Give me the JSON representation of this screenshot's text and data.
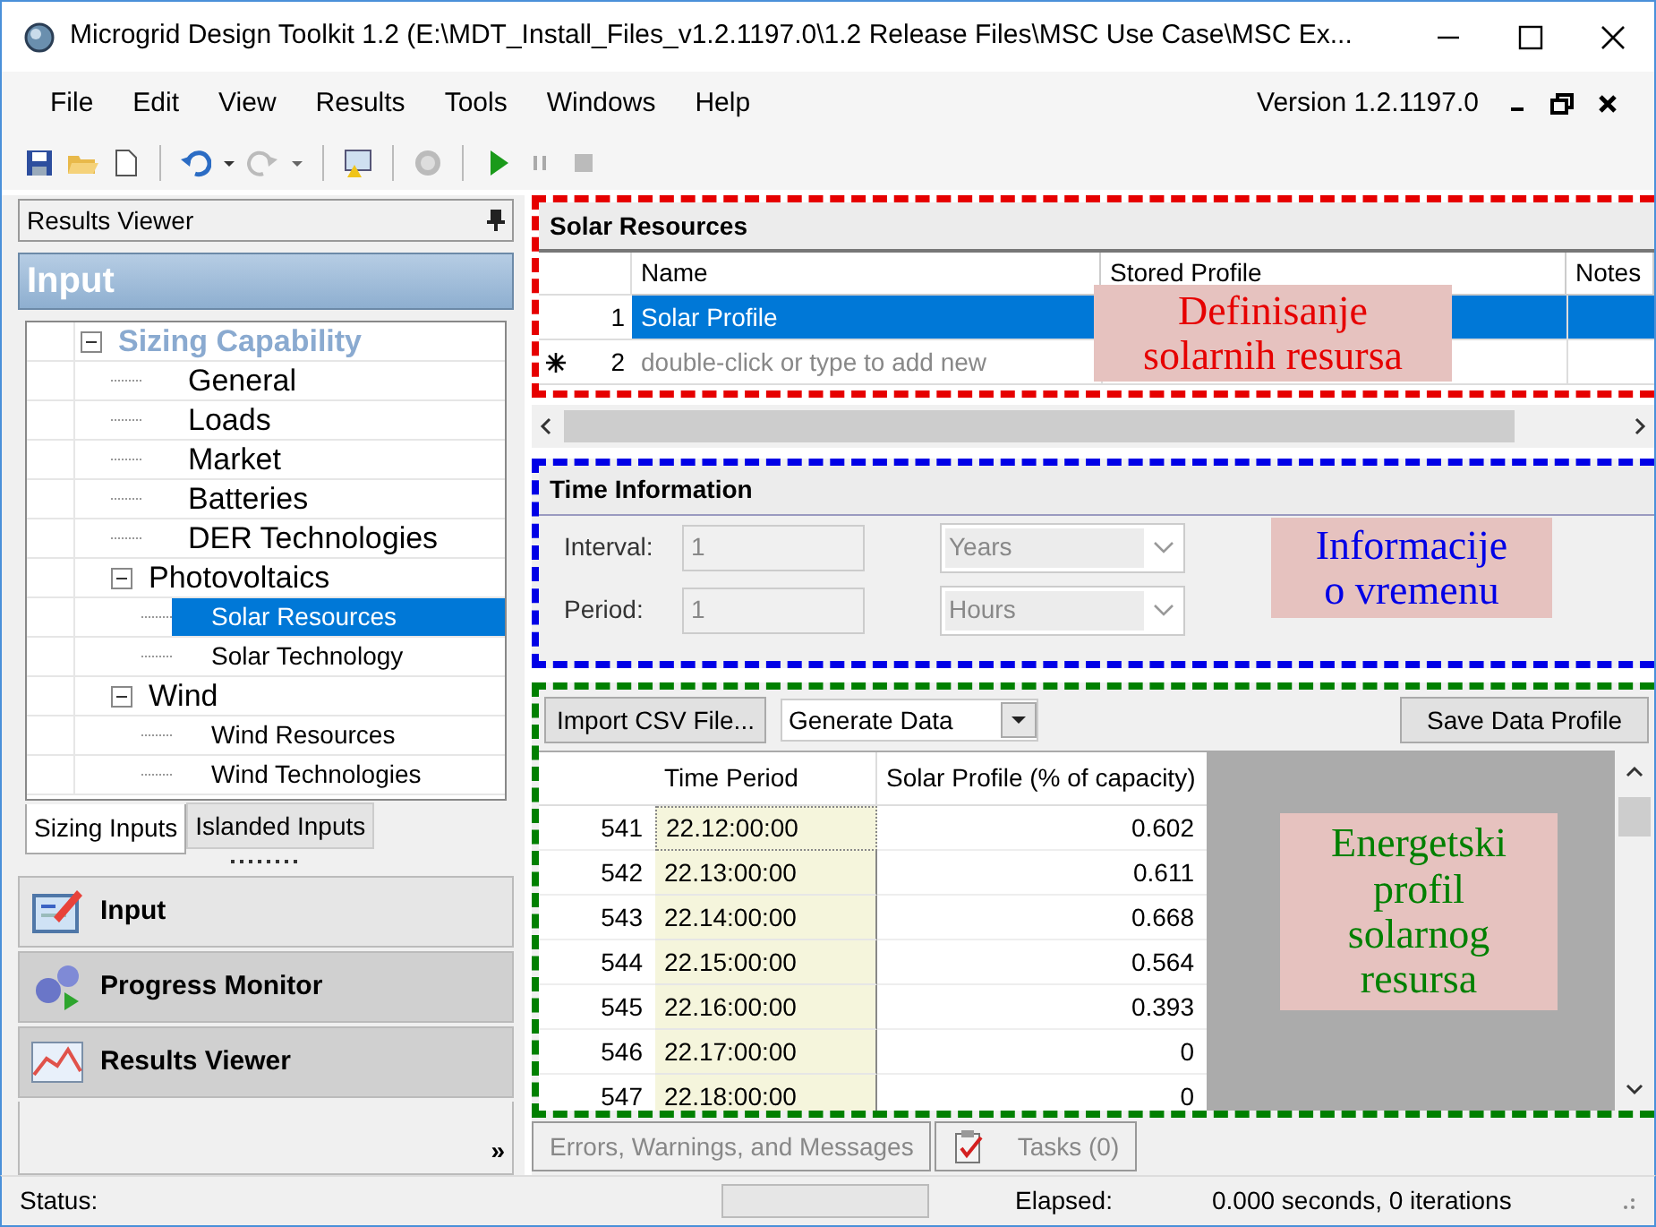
{
  "window": {
    "title": "Microgrid Design Toolkit 1.2 (E:\\MDT_Install_Files_v1.2.1197.0\\1.2 Release Files\\MSC Use Case\\MSC Ex..."
  },
  "menu": [
    "File",
    "Edit",
    "View",
    "Results",
    "Tools",
    "Windows",
    "Help"
  ],
  "version": "Version 1.2.1197.0",
  "left_panel": {
    "header": "Results Viewer",
    "section_title": "Input",
    "tree": [
      {
        "label": "Sizing Capability",
        "expanded": true,
        "children": [
          {
            "label": "General",
            "selected": false
          },
          {
            "label": "Loads",
            "selected": false
          },
          {
            "label": "Market",
            "selected": false
          },
          {
            "label": "Batteries",
            "selected": false
          },
          {
            "label": "DER Technologies",
            "selected": false
          },
          {
            "label": "Photovoltaics",
            "expanded": true,
            "selected": false,
            "children": [
              {
                "label": "Solar Resources",
                "selected": true
              },
              {
                "label": "Solar Technology",
                "selected": false
              }
            ]
          },
          {
            "label": "Wind",
            "expanded": true,
            "selected": false,
            "children": [
              {
                "label": "Wind Resources",
                "selected": false
              },
              {
                "label": "Wind Technologies",
                "selected": false
              }
            ]
          }
        ]
      }
    ],
    "tabs": [
      {
        "label": "Sizing Inputs",
        "selected": true
      },
      {
        "label": "Islanded Inputs",
        "selected": false
      }
    ],
    "nav_buttons": [
      {
        "label": "Input",
        "kind": "input",
        "selected": true
      },
      {
        "label": "Progress Monitor",
        "kind": "progress",
        "selected": false
      },
      {
        "label": "Results Viewer",
        "kind": "results",
        "selected": false
      }
    ],
    "more": "»"
  },
  "solar_resources": {
    "title": "Solar Resources",
    "columns": [
      "Name",
      "Stored Profile",
      "Notes"
    ],
    "rows": [
      {
        "number": "1",
        "name": "Solar Profile",
        "selected": true,
        "kind": "row"
      },
      {
        "number": "2",
        "name": "double-click or type to add new",
        "selected": false,
        "kind": "new"
      }
    ]
  },
  "time_information": {
    "title": "Time Information",
    "fields": [
      {
        "label": "Interval:",
        "value": "1",
        "unit": "Years",
        "disabled": true
      },
      {
        "label": "Period:",
        "value": "1",
        "unit": "Hours",
        "disabled": true
      }
    ]
  },
  "data_profile": {
    "import_button": "Import CSV File...",
    "generate": "Generate Data",
    "save_button": "Save Data Profile",
    "columns": [
      "Time Period",
      "Solar Profile (% of capacity)"
    ],
    "rows": [
      {
        "number": "541",
        "time": "22.12:00:00",
        "value": "0.602"
      },
      {
        "number": "542",
        "time": "22.13:00:00",
        "value": "0.611"
      },
      {
        "number": "543",
        "time": "22.14:00:00",
        "value": "0.668"
      },
      {
        "number": "544",
        "time": "22.15:00:00",
        "value": "0.564"
      },
      {
        "number": "545",
        "time": "22.16:00:00",
        "value": "0.393"
      },
      {
        "number": "546",
        "time": "22.17:00:00",
        "value": "0"
      },
      {
        "number": "547",
        "time": "22.18:00:00",
        "value": "0"
      }
    ]
  },
  "annotations": [
    {
      "text": "Definisanje\nsolarnih resursa",
      "color": "#e60000"
    },
    {
      "text": "Informacije\no vremenu",
      "color": "#0000e6"
    },
    {
      "text": "Energetski\nprofil\nsolarnog\nresursa",
      "color": "#008000"
    }
  ],
  "bottom_tabs": [
    {
      "label": "Errors, Warnings, and Messages",
      "kind": "plain"
    },
    {
      "label": "Tasks (0)",
      "kind": "tasks"
    }
  ],
  "status_bar": {
    "status": "Status:",
    "progress": {
      "level": 0
    },
    "elapsed_label": "Elapsed:",
    "elapsed": "0.000 seconds, 0 iterations"
  }
}
